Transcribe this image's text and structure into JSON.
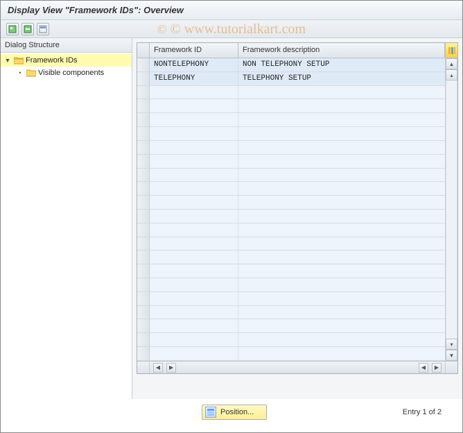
{
  "title": "Display View \"Framework IDs\": Overview",
  "watermark": "© www.tutorialkart.com",
  "toolbar": {
    "btn1_name": "expand-all-icon",
    "btn2_name": "collapse-all-icon",
    "btn3_name": "select-block-icon"
  },
  "tree": {
    "header": "Dialog Structure",
    "root": {
      "label": "Framework IDs",
      "expanded": true
    },
    "child": {
      "label": "Visible components"
    }
  },
  "grid": {
    "columns": {
      "col1": "Framework ID",
      "col2": "Framework description"
    },
    "rows": [
      {
        "id": "NONTELEPHONY",
        "desc": "NON TELEPHONY SETUP"
      },
      {
        "id": "TELEPHONY",
        "desc": "TELEPHONY SETUP"
      }
    ],
    "blank_rows": 20
  },
  "footer": {
    "position_btn": "Position...",
    "entry_text": "Entry 1 of 2"
  }
}
